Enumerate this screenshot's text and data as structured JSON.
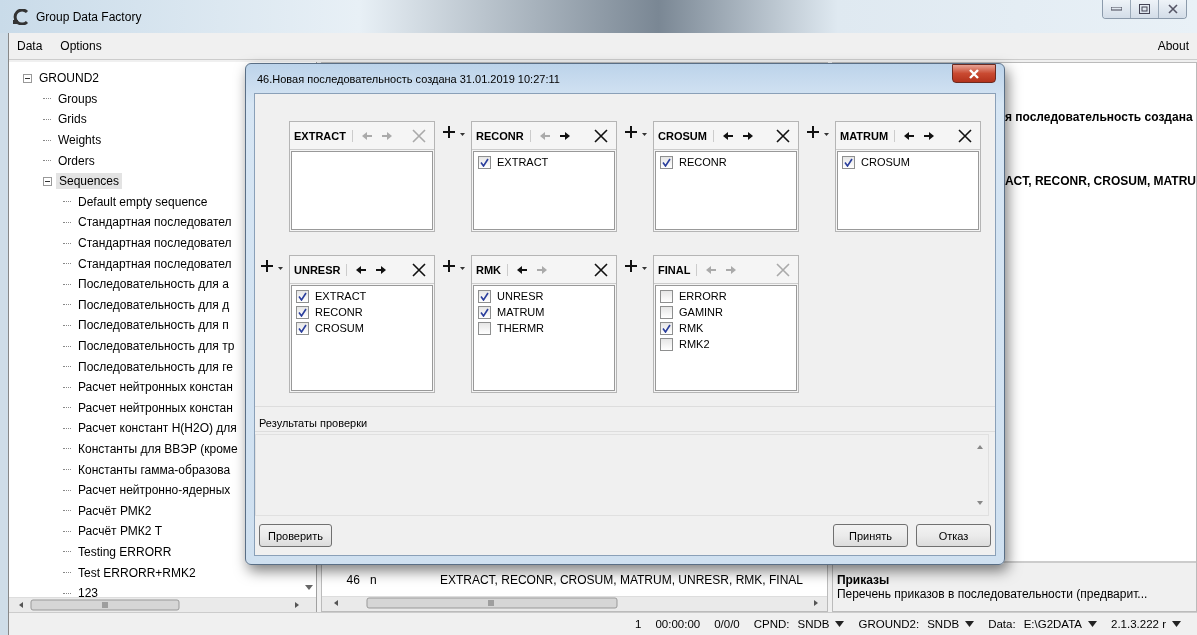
{
  "window": {
    "title": "Group Data Factory"
  },
  "menu": {
    "items": [
      {
        "label": "Data"
      },
      {
        "label": "Options"
      }
    ],
    "about": {
      "label": "About"
    }
  },
  "tree": {
    "label": "GROUND2",
    "expanded": true,
    "selected": false,
    "children": [
      {
        "label": "Groups",
        "selected": false
      },
      {
        "label": "Grids",
        "selected": false
      },
      {
        "label": "Weights",
        "selected": false
      },
      {
        "label": "Orders",
        "selected": false
      },
      {
        "label": "Sequences",
        "expanded": true,
        "selected": true,
        "children": [
          {
            "label": "Default empty sequence",
            "selected": false
          },
          {
            "label": "Стандартная последовател",
            "selected": false
          },
          {
            "label": "Стандартная последовател",
            "selected": false
          },
          {
            "label": "Стандартная последовател",
            "selected": false
          },
          {
            "label": "Последовательность для а",
            "selected": false
          },
          {
            "label": "Последовательность для д",
            "selected": false
          },
          {
            "label": "Последовательность для п",
            "selected": false
          },
          {
            "label": "Последовательность для тр",
            "selected": false
          },
          {
            "label": "Последовательность для ге",
            "selected": false
          },
          {
            "label": "Расчет нейтронных констан",
            "selected": false
          },
          {
            "label": "Расчет нейтронных констан",
            "selected": false
          },
          {
            "label": "Расчет констант H(H2O) для",
            "selected": false
          },
          {
            "label": "Константы для ВВЭР (кроме",
            "selected": false
          },
          {
            "label": "Константы гамма-образова",
            "selected": false
          },
          {
            "label": "Расчет нейтронно-ядерных",
            "selected": false
          },
          {
            "label": "Расчёт РМК2",
            "selected": false
          },
          {
            "label": "Расчёт РМК2 Т",
            "selected": false
          },
          {
            "label": "Testing ERRORR",
            "selected": false
          },
          {
            "label": "Test ERRORR+RMK2",
            "selected": false
          },
          {
            "label": "123",
            "selected": false
          }
        ]
      }
    ]
  },
  "sequence_table": {
    "rows": [
      {
        "number": "46",
        "flag": "n",
        "steps": "EXTRACT, RECONR, CROSUM, MATRUM, UNRESR, RMK, FINAL"
      }
    ]
  },
  "details": {
    "name_fragment": "я последовательность создана",
    "steps_fragment": "ACT, RECONR, CROSUM, MATRU"
  },
  "orders_section": {
    "heading": "Приказы",
    "description": "Перечень приказов в последовательности (предварит..."
  },
  "dialog": {
    "title": "46.Новая последовательность создана 31.01.2019 10:27:11",
    "steps": [
      {
        "name": "EXTRACT",
        "insert_button": false,
        "move_left_enabled": false,
        "move_right_enabled": false,
        "remove_enabled": false
      },
      {
        "name": "RECONR",
        "insert_button": true,
        "move_left_enabled": false,
        "move_right_enabled": true,
        "remove_enabled": true,
        "inputs": [
          {
            "label": "EXTRACT",
            "checked": true
          }
        ]
      },
      {
        "name": "CROSUM",
        "insert_button": true,
        "move_left_enabled": true,
        "move_right_enabled": true,
        "remove_enabled": true,
        "inputs": [
          {
            "label": "RECONR",
            "checked": true
          }
        ]
      },
      {
        "name": "MATRUM",
        "insert_button": true,
        "move_left_enabled": true,
        "move_right_enabled": true,
        "remove_enabled": true,
        "inputs": [
          {
            "label": "CROSUM",
            "checked": true
          }
        ]
      },
      {
        "name": "UNRESR",
        "insert_button": true,
        "move_left_enabled": true,
        "move_right_enabled": true,
        "remove_enabled": true,
        "inputs": [
          {
            "label": "EXTRACT",
            "checked": true
          },
          {
            "label": "RECONR",
            "checked": true
          },
          {
            "label": "CROSUM",
            "checked": true
          }
        ]
      },
      {
        "name": "RMK",
        "insert_button": true,
        "move_left_enabled": true,
        "move_right_enabled": false,
        "remove_enabled": true,
        "inputs": [
          {
            "label": "UNRESR",
            "checked": true
          },
          {
            "label": "MATRUM",
            "checked": true
          },
          {
            "label": "THERMR",
            "checked": false
          }
        ]
      },
      {
        "name": "FINAL",
        "insert_button": true,
        "move_left_enabled": false,
        "move_right_enabled": false,
        "remove_enabled": false,
        "inputs": [
          {
            "label": "ERRORR",
            "checked": false
          },
          {
            "label": "GAMINR",
            "checked": false
          },
          {
            "label": "RMK",
            "checked": true
          },
          {
            "label": "RMK2",
            "checked": false
          }
        ]
      }
    ],
    "results_label": "Результаты проверки",
    "buttons": {
      "check": "Проверить",
      "accept": "Принять",
      "cancel": "Отказ"
    }
  },
  "status_bar": {
    "count": "1",
    "time": "00:00:00",
    "progress": "0/0/0",
    "selectors": [
      {
        "label": "CPND:",
        "value": "SNDB"
      },
      {
        "label": "GROUND2:",
        "value": "SNDB"
      },
      {
        "label": "Data:",
        "value": "E:\\G2DATA"
      },
      {
        "value": "2.1.3.222 r"
      }
    ]
  }
}
